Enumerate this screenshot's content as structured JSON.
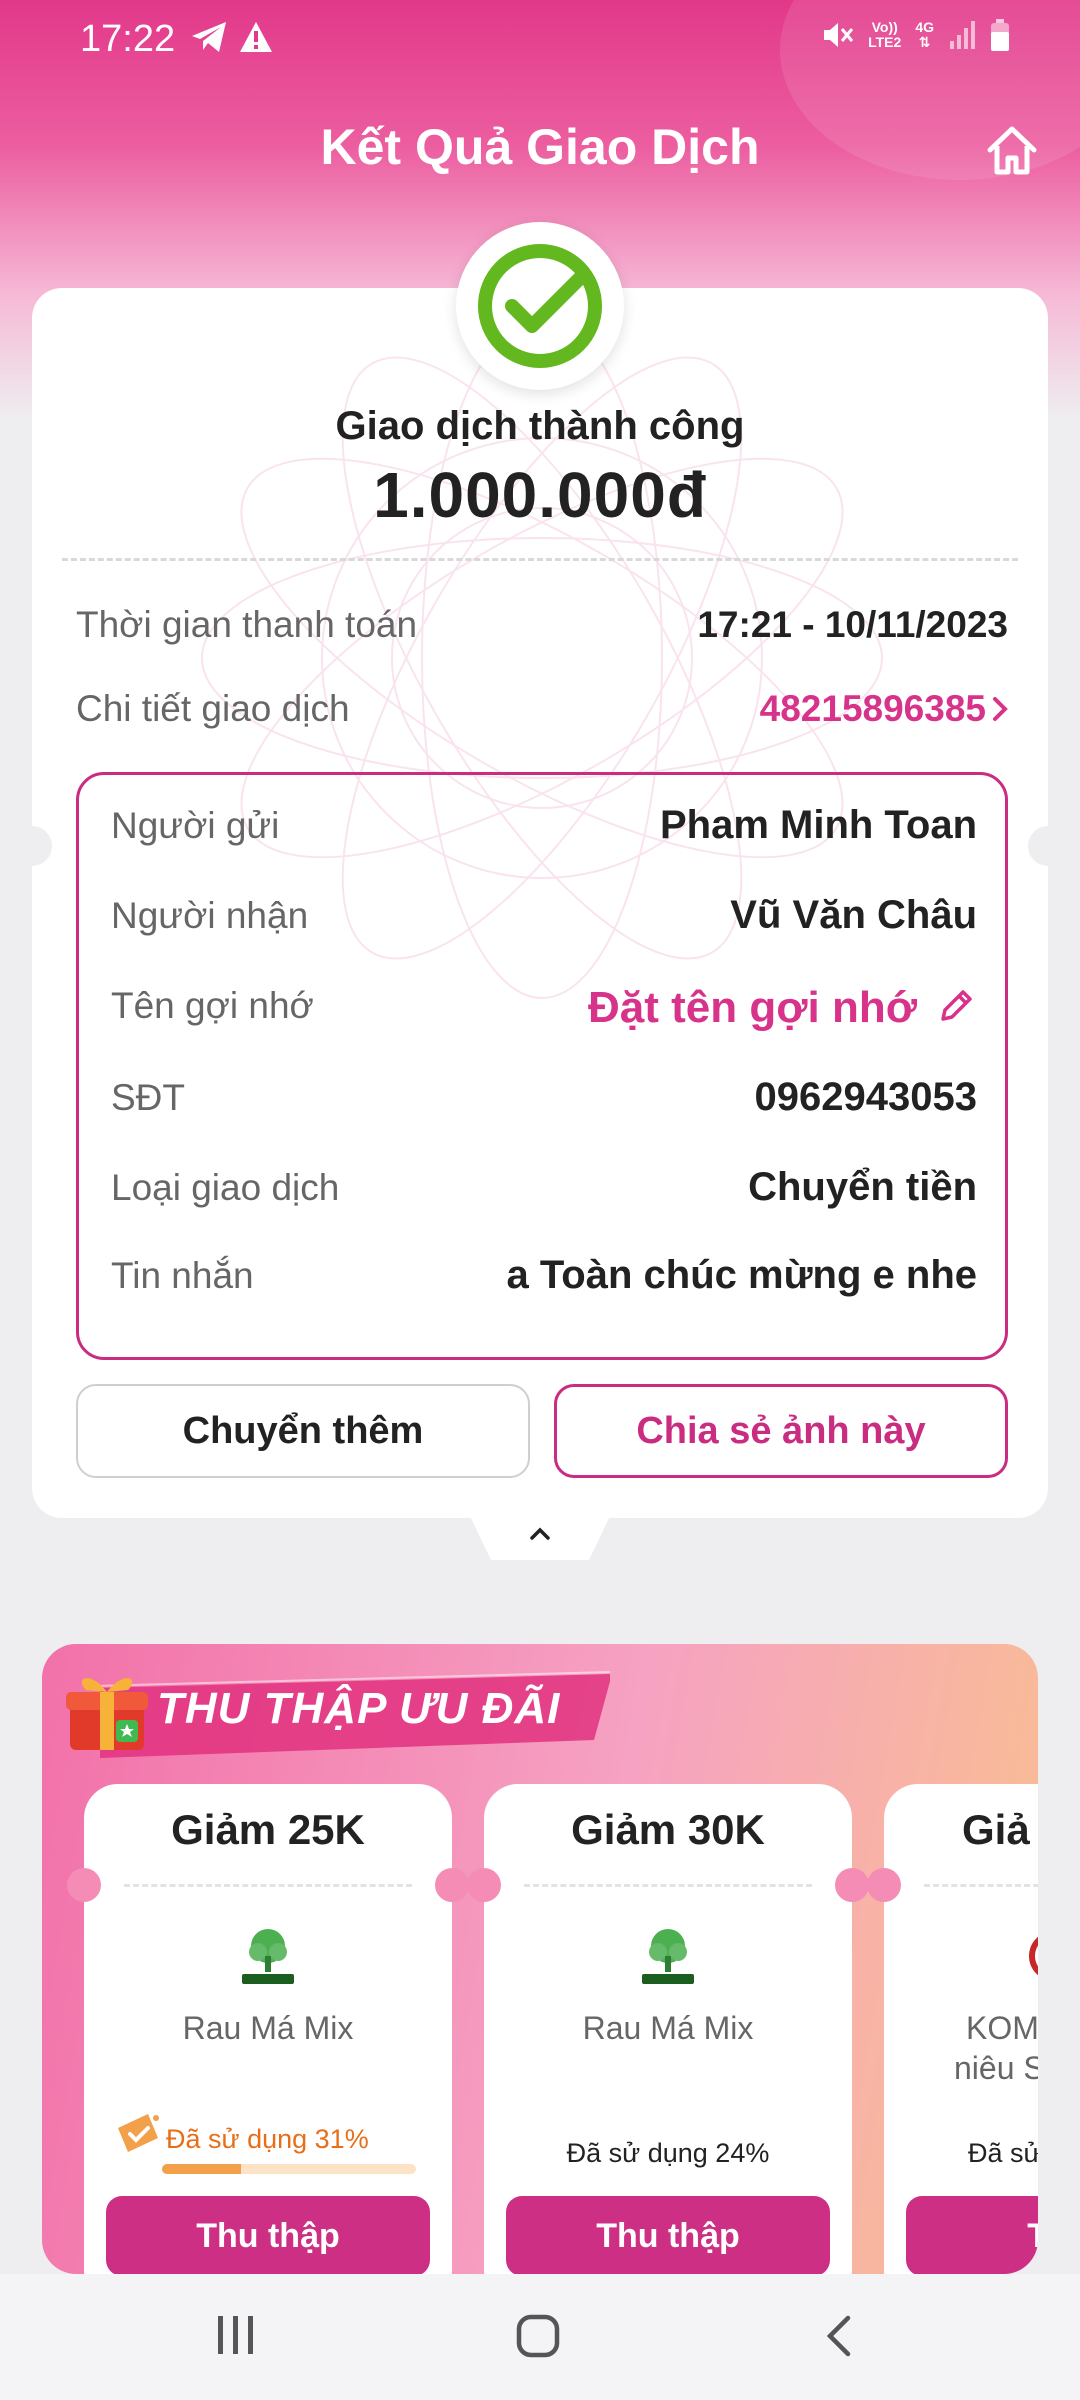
{
  "status_bar": {
    "time": "17:22",
    "icons": [
      "telegram-icon",
      "warning-icon",
      "mute-icon",
      "volte-icon",
      "4g-icon",
      "signal-icon",
      "battery-icon"
    ],
    "volte_line1": "Vo))",
    "volte_line2": "LTE2",
    "network": "4G"
  },
  "header": {
    "title": "Kết Quả Giao Dịch",
    "home_icon": "home-icon"
  },
  "result": {
    "status": "Giao dịch thành công",
    "amount": "1.000.000đ"
  },
  "info": {
    "time_label": "Thời gian thanh toán",
    "time_value": "17:21 - 10/11/2023",
    "detail_label": "Chi tiết giao dịch",
    "detail_value": "48215896385"
  },
  "details": [
    {
      "label": "Người gửi",
      "value": "Pham Minh Toan"
    },
    {
      "label": "Người nhận",
      "value": "Vũ Văn Châu"
    },
    {
      "label": "Tên gợi nhớ",
      "value": "Đặt tên gợi nhớ"
    },
    {
      "label": "SĐT",
      "value": "0962943053"
    },
    {
      "label": "Loại giao dịch",
      "value": "Chuyển tiền"
    },
    {
      "label": "Tin nhắn",
      "value": "a Toàn chúc mừng e nhe"
    }
  ],
  "actions": {
    "more": "Chuyển thêm",
    "share": "Chia sẻ ảnh này"
  },
  "colors": {
    "brand": "#d8338a",
    "button": "#cd2f84",
    "success": "#62b81e"
  },
  "promo": {
    "title": "THU THẬP ƯU ĐÃI",
    "coupons": [
      {
        "title": "Giảm 25K",
        "merchant": "Rau Má Mix",
        "used": "Đã sử dụng 31%",
        "used_fraction": 0.31,
        "button": "Thu thập"
      },
      {
        "title": "Giảm 30K",
        "merchant": "Rau Má Mix",
        "used": "Đã sử dụng 24%",
        "button": "Thu thập"
      },
      {
        "title": "Giả",
        "merchant": "KOM",
        "merchant2": "niêu S",
        "used": "Đã sử",
        "button": "Th"
      }
    ]
  }
}
